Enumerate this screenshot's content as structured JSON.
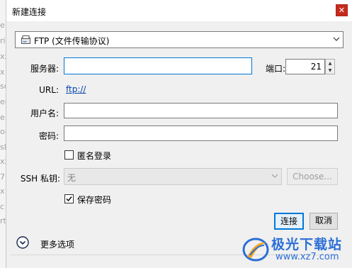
{
  "background_strip": [
    "e",
    "rive",
    "xx",
    "x",
    "sc",
    "er",
    "e",
    "on",
    "sk",
    "xx",
    "7",
    "x",
    "c",
    "rt"
  ],
  "dialog": {
    "title": "新建连接",
    "close_label": "✕"
  },
  "protocol": {
    "selected": "FTP (文件传输协议)"
  },
  "server": {
    "label": "服务器:",
    "value": ""
  },
  "port": {
    "label": "端口:",
    "value": "21"
  },
  "url": {
    "label": "URL:",
    "value": "ftp://"
  },
  "username": {
    "label": "用户名:",
    "value": ""
  },
  "password": {
    "label": "密码:",
    "value": ""
  },
  "anonymous": {
    "label": "匿名登录",
    "checked": false
  },
  "ssh_key": {
    "label": "SSH 私钥:",
    "value": "无",
    "choose_label": "Choose..."
  },
  "save_password": {
    "label": "保存密码",
    "checked": true
  },
  "buttons": {
    "connect": "连接",
    "cancel": "取消"
  },
  "more_options": {
    "label": "更多选项"
  },
  "watermark": {
    "name": "极光下载站",
    "url": "www.xz7.com"
  },
  "colors": {
    "accent": "#0078d7",
    "close": "#c42b1c",
    "link": "#0645ad",
    "watermark": "#2b6fd6"
  }
}
